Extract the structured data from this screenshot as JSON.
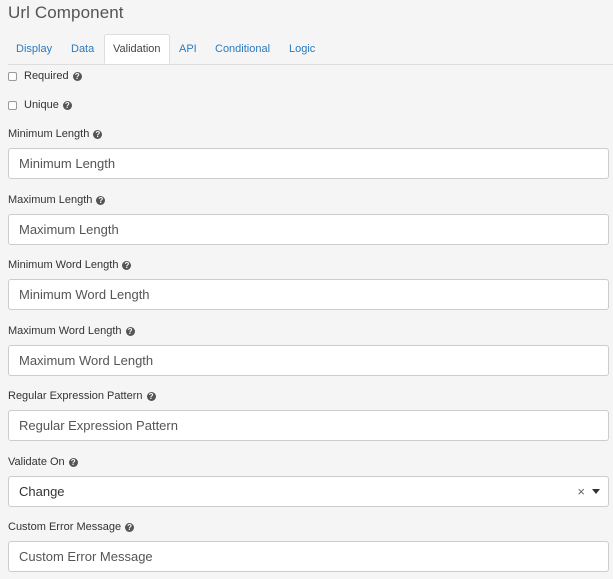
{
  "component_title": "Url Component",
  "tabs": [
    {
      "label": "Display"
    },
    {
      "label": "Data"
    },
    {
      "label": "Validation"
    },
    {
      "label": "API"
    },
    {
      "label": "Conditional"
    },
    {
      "label": "Logic"
    }
  ],
  "active_tab": "Validation",
  "checkboxes": {
    "required": {
      "label": "Required",
      "checked": false
    },
    "unique": {
      "label": "Unique",
      "checked": false
    }
  },
  "fields": {
    "min_length": {
      "label": "Minimum Length",
      "placeholder": "Minimum Length"
    },
    "max_length": {
      "label": "Maximum Length",
      "placeholder": "Maximum Length"
    },
    "min_word_length": {
      "label": "Minimum Word Length",
      "placeholder": "Minimum Word Length"
    },
    "max_word_length": {
      "label": "Maximum Word Length",
      "placeholder": "Maximum Word Length"
    },
    "regex": {
      "label": "Regular Expression Pattern",
      "placeholder": "Regular Expression Pattern"
    },
    "validate_on": {
      "label": "Validate On",
      "value": "Change",
      "clear": "×"
    },
    "custom_error": {
      "label": "Custom Error Message",
      "placeholder": "Custom Error Message"
    }
  },
  "help_icon": "?"
}
